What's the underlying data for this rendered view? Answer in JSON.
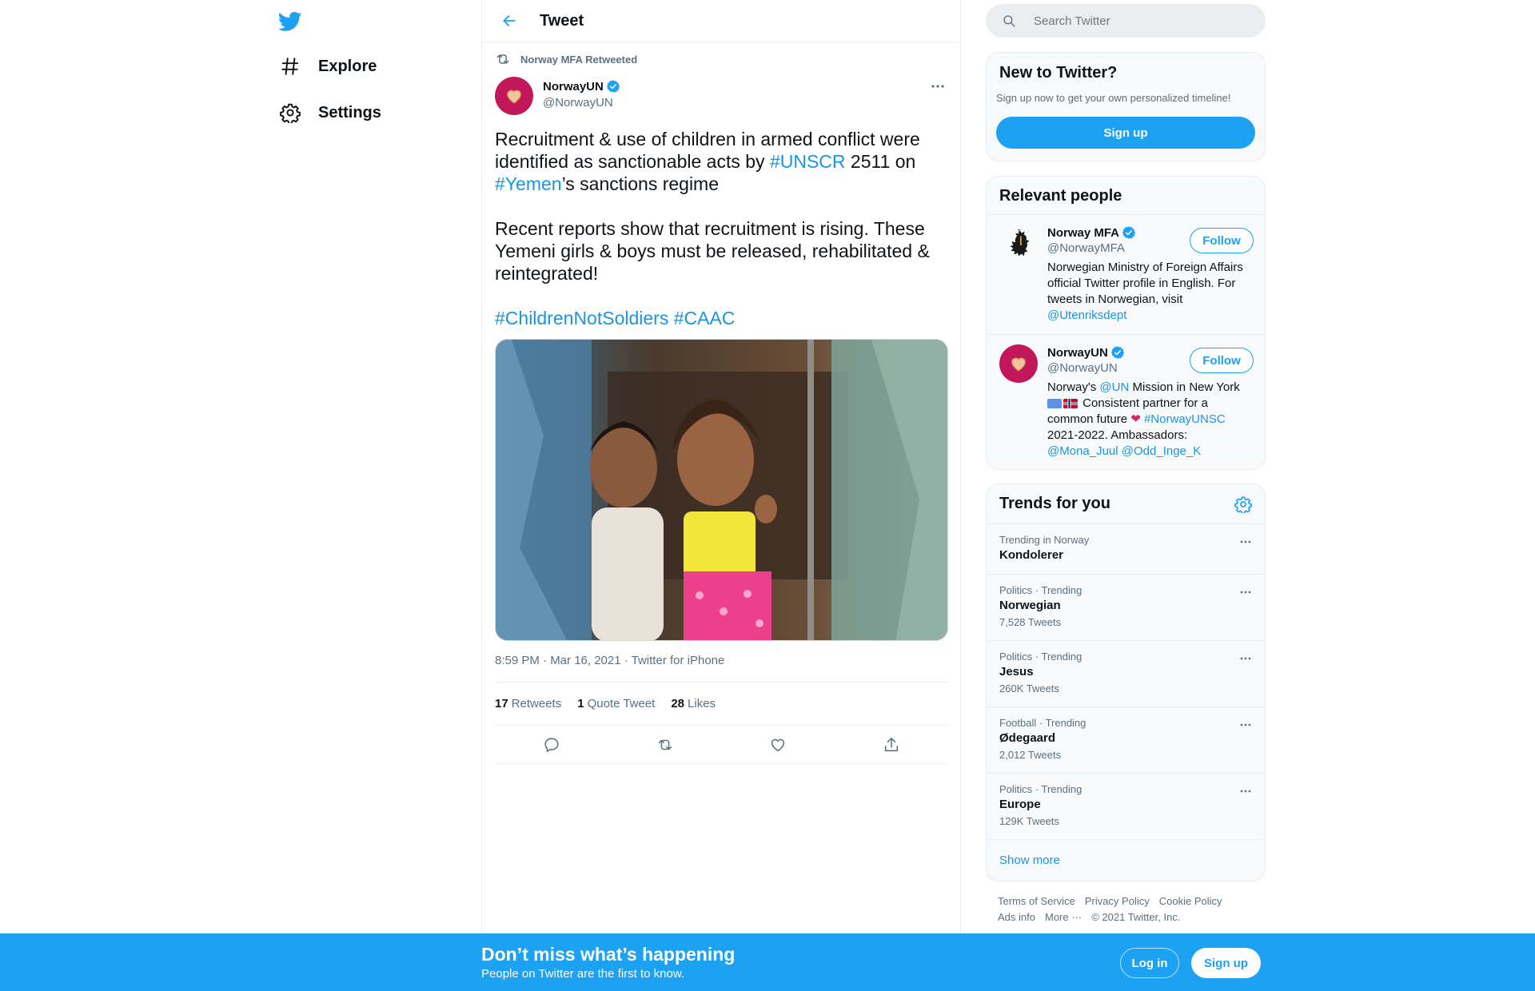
{
  "colors": {
    "accent": "#1da1f2",
    "link": "#1b95e0",
    "text": "#0f1419",
    "muted": "#5b7083",
    "avatar_bg": "#c2185b"
  },
  "nav": {
    "logo_icon": "twitter-bird-icon",
    "items": [
      {
        "label": "Explore",
        "icon": "hashtag-icon"
      },
      {
        "label": "Settings",
        "icon": "gear-icon"
      }
    ]
  },
  "header": {
    "title": "Tweet",
    "back_icon": "arrow-left-icon"
  },
  "tweet": {
    "retweeted_by": "Norway MFA Retweeted",
    "author_name": "NorwayUN",
    "author_handle": "@NorwayUN",
    "text_p1_a": "Recruitment & use of children in armed conflict were identified as sanctionable acts by ",
    "text_p1_tag1": "#UNSCR",
    "text_p1_b": " 2511 on ",
    "text_p1_tag2": "#Yemen",
    "text_p1_c": "’s sanctions regime",
    "text_p2": "Recent reports show that recruitment is rising. These Yemeni girls & boys must be released, rehabilitated & reintegrated!",
    "text_p3_tag1": "#ChildrenNotSoldiers",
    "text_p3_tag2": "#CAAC",
    "meta": "8:59 PM · Mar 16, 2021 · Twitter for iPhone",
    "retweets_count": "17",
    "retweets_label": "Retweets",
    "quotes_count": "1",
    "quotes_label": "Quote Tweet",
    "likes_count": "28",
    "likes_label": "Likes",
    "actions": [
      "reply-icon",
      "retweet-icon",
      "like-icon",
      "share-icon"
    ]
  },
  "search": {
    "placeholder": "Search Twitter"
  },
  "new_to_twitter": {
    "title": "New to Twitter?",
    "subtitle": "Sign up now to get your own personalized timeline!",
    "button": "Sign up"
  },
  "relevant_people": {
    "title": "Relevant people",
    "people": [
      {
        "name": "Norway MFA",
        "handle": "@NorwayMFA",
        "follow": "Follow",
        "bio": "Norwegian Ministry of Foreign Affairs official Twitter profile in English. For tweets in Norwegian, visit ",
        "bio_link": "@Utenriksdept"
      },
      {
        "name": "NorwayUN",
        "handle": "@NorwayUN",
        "follow": "Follow",
        "bio_a": "Norway's ",
        "bio_link1": "@UN",
        "bio_b": " Mission in New York ",
        "bio_c": " Consistent partner for a common future ",
        "bio_link2": "#NorwayUNSC",
        "bio_d": " 2021-2022. Ambassadors: ",
        "bio_link3": "@Mona_Juul",
        "bio_link4": "@Odd_Inge_K"
      }
    ]
  },
  "trends": {
    "title": "Trends for you",
    "items": [
      {
        "context": "Trending in Norway",
        "name": "Kondolerer",
        "count": ""
      },
      {
        "context": "Politics · Trending",
        "name": "Norwegian",
        "count": "7,528 Tweets"
      },
      {
        "context": "Politics · Trending",
        "name": "Jesus",
        "count": "260K Tweets"
      },
      {
        "context": "Football · Trending",
        "name": "Ødegaard",
        "count": "2,012 Tweets"
      },
      {
        "context": "Politics · Trending",
        "name": "Europe",
        "count": "129K Tweets"
      }
    ],
    "show_more": "Show more"
  },
  "footer": {
    "links": [
      "Terms of Service",
      "Privacy Policy",
      "Cookie Policy",
      "Ads info",
      "More ···"
    ],
    "copyright": "© 2021 Twitter, Inc."
  },
  "bottom_bar": {
    "title": "Don’t miss what’s happening",
    "subtitle": "People on Twitter are the first to know.",
    "login": "Log in",
    "signup": "Sign up"
  }
}
